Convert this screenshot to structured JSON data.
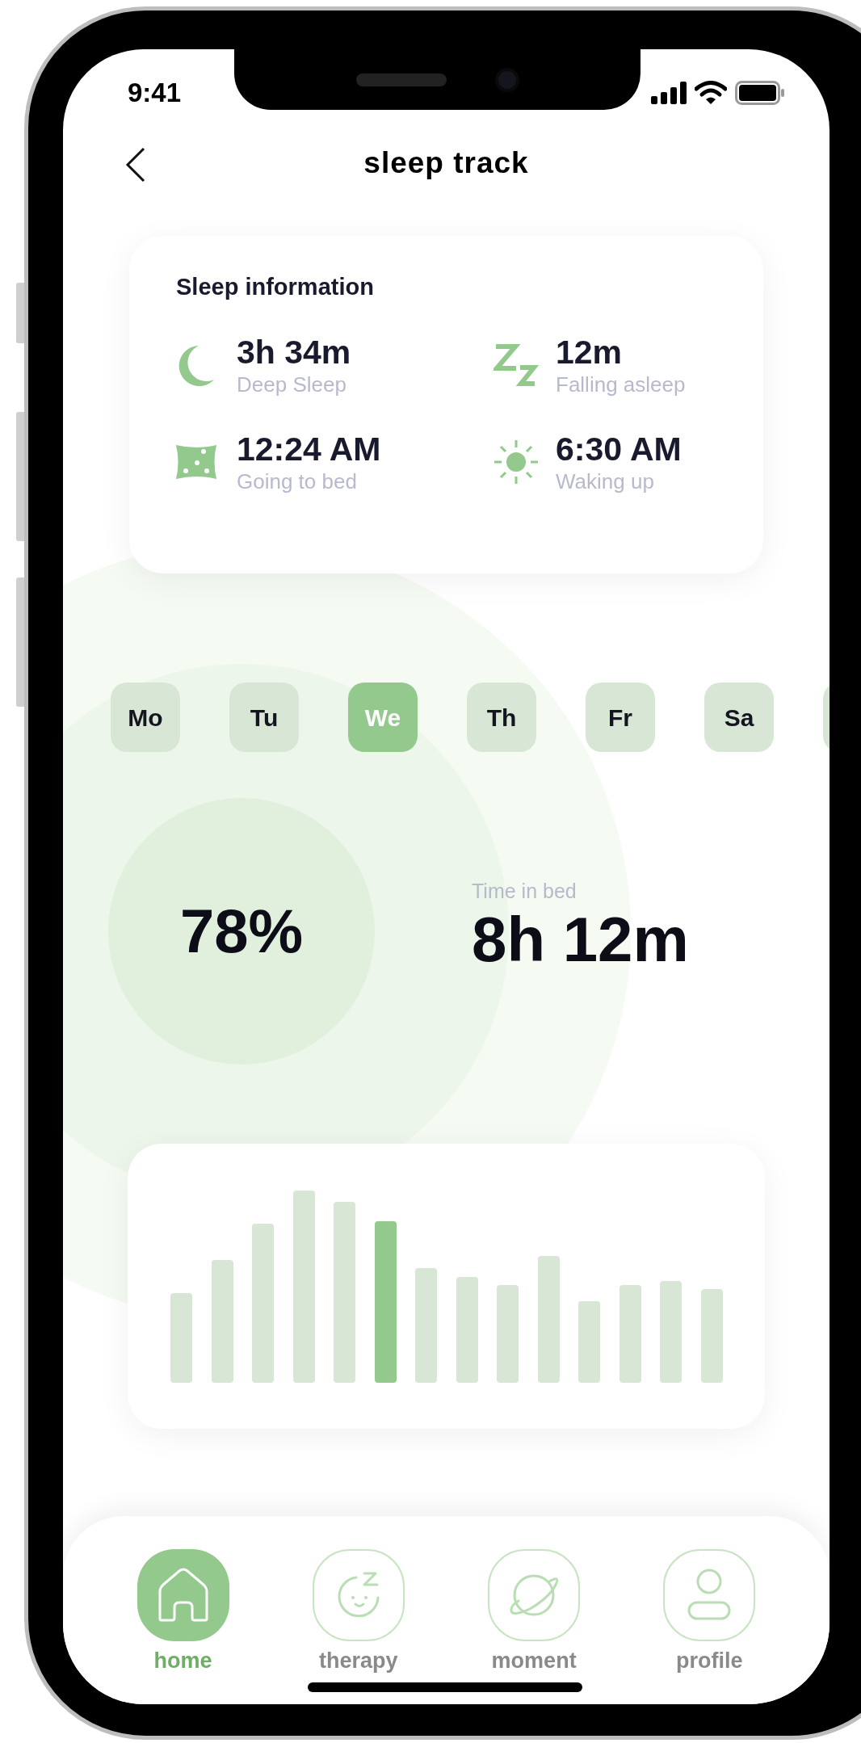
{
  "status_bar": {
    "time": "9:41"
  },
  "header": {
    "title": "sleep track"
  },
  "sleep_information": {
    "title": "Sleep information",
    "items": [
      {
        "kind": "moon",
        "value": "3h 34m",
        "label": "Deep Sleep"
      },
      {
        "kind": "zz",
        "value": "12m",
        "label": "Falling asleep"
      },
      {
        "kind": "pillow",
        "value": "12:24 AM",
        "label": "Going to bed"
      },
      {
        "kind": "sun",
        "value": "6:30 AM",
        "label": "Waking up"
      }
    ]
  },
  "days": [
    {
      "label": "Mo",
      "selected": false
    },
    {
      "label": "Tu",
      "selected": false
    },
    {
      "label": "We",
      "selected": true
    },
    {
      "label": "Th",
      "selected": false
    },
    {
      "label": "Fr",
      "selected": false
    },
    {
      "label": "Sa",
      "selected": false
    }
  ],
  "summary": {
    "score": "78%",
    "time_in_bed_label": "Time in bed",
    "time_in_bed": "8h 12m"
  },
  "nav": [
    {
      "kind": "home",
      "label": "home",
      "selected": true
    },
    {
      "kind": "therapy",
      "label": "therapy",
      "selected": false
    },
    {
      "kind": "moment",
      "label": "moment",
      "selected": false
    },
    {
      "kind": "profile",
      "label": "profile",
      "selected": false
    }
  ]
}
